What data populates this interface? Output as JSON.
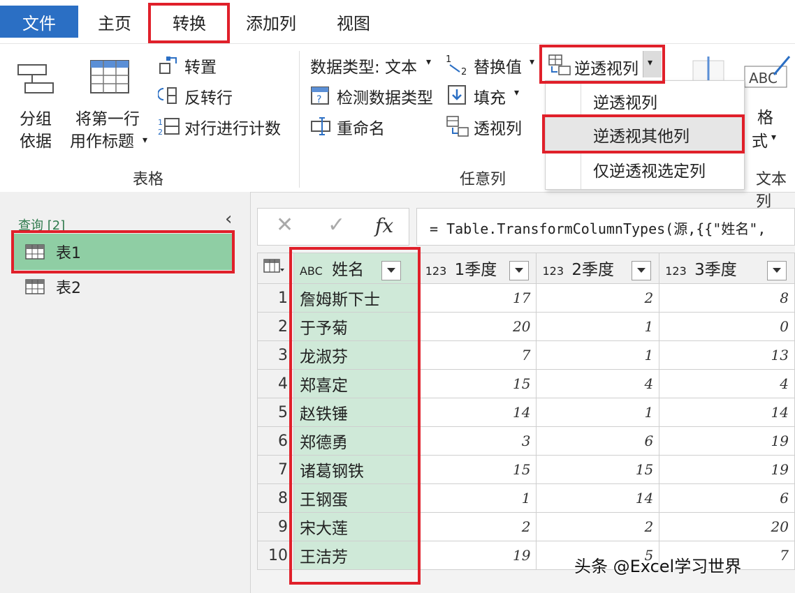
{
  "menu": {
    "file": "文件",
    "tabs": [
      "主页",
      "转换",
      "添加列",
      "视图"
    ]
  },
  "ribbon": {
    "table_group": {
      "group_by": [
        "分组",
        "依据"
      ],
      "first_row_header": [
        "将第一行",
        "用作标题"
      ],
      "transpose": "转置",
      "reverse_rows": "反转行",
      "count_rows": "对行进行计数",
      "label": "表格"
    },
    "any_column_group": {
      "data_type_label": "数据类型: 文本",
      "detect_type": "检测数据类型",
      "rename": "重命名",
      "replace_values": "替换值",
      "fill": "填充",
      "pivot": "透视列",
      "unpivot": "逆透视列",
      "label": "任意列"
    },
    "text_group": {
      "format": [
        "格",
        "式"
      ],
      "label": "文本列",
      "abc_icon_text": "ABC"
    },
    "unpivot_menu": {
      "items": [
        "逆透视列",
        "逆透视其他列",
        "仅逆透视选定列"
      ]
    }
  },
  "queries": {
    "title": "查询 [2]",
    "items": [
      "表1",
      "表2"
    ]
  },
  "formula": {
    "cancel": "✕",
    "confirm": "✓",
    "fx": "fx",
    "text": "= Table.TransformColumnTypes(源,{{\"姓名\","
  },
  "table": {
    "headers": [
      {
        "type": "ABC",
        "name": "姓名"
      },
      {
        "type": "123",
        "name": "1季度"
      },
      {
        "type": "123",
        "name": "2季度"
      },
      {
        "type": "123",
        "name": "3季度"
      }
    ],
    "rows": [
      {
        "n": "1",
        "name": "詹姆斯下士",
        "q1": "17",
        "q2": "2",
        "q3": "8"
      },
      {
        "n": "2",
        "name": "于予菊",
        "q1": "20",
        "q2": "1",
        "q3": "0"
      },
      {
        "n": "3",
        "name": "龙淑芬",
        "q1": "7",
        "q2": "1",
        "q3": "13"
      },
      {
        "n": "4",
        "name": "郑喜定",
        "q1": "15",
        "q2": "4",
        "q3": "4"
      },
      {
        "n": "5",
        "name": "赵铁锤",
        "q1": "14",
        "q2": "1",
        "q3": "14"
      },
      {
        "n": "6",
        "name": "郑德勇",
        "q1": "3",
        "q2": "6",
        "q3": "19"
      },
      {
        "n": "7",
        "name": "诸葛钢铁",
        "q1": "15",
        "q2": "15",
        "q3": "19"
      },
      {
        "n": "8",
        "name": "王钢蛋",
        "q1": "1",
        "q2": "14",
        "q3": "6"
      },
      {
        "n": "9",
        "name": "宋大莲",
        "q1": "2",
        "q2": "2",
        "q3": "20"
      },
      {
        "n": "10",
        "name": "王洁芳",
        "q1": "19",
        "q2": "5",
        "q3": "7"
      }
    ]
  },
  "watermark": "头条 @Excel学习世界",
  "colors": {
    "file_tab": "#2b6fc4",
    "highlight_red": "#e0202a",
    "selected_green": "#8fcea4",
    "name_column": "#cfe9d8"
  }
}
